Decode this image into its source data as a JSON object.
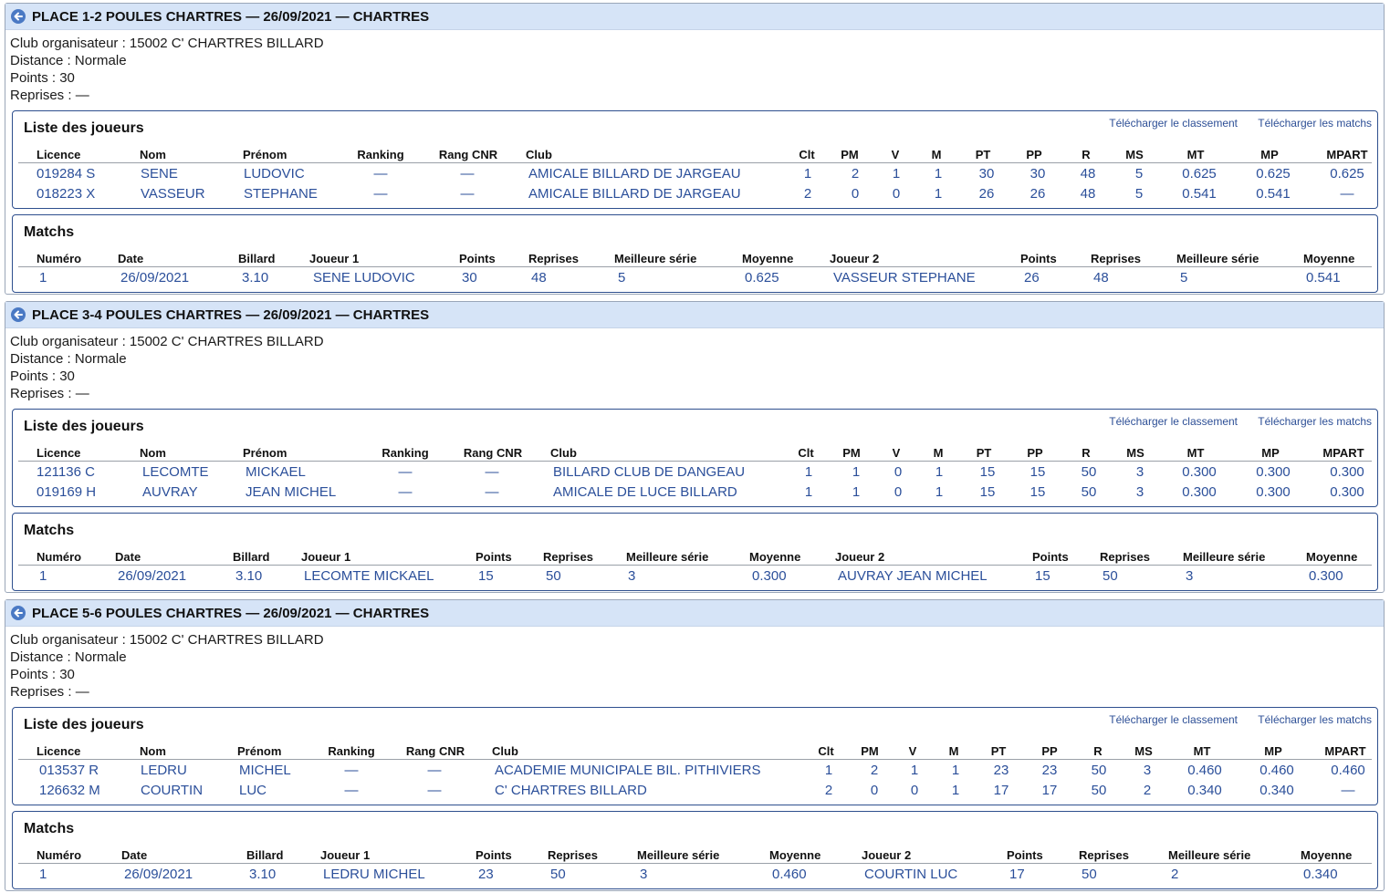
{
  "labels": {
    "club": "Club organisateur : ",
    "distance": "Distance : ",
    "points": "Points : ",
    "reprises": "Reprises : ",
    "players_title": "Liste des joueurs",
    "matches_title": "Matchs",
    "download_ranking": "Télécharger le classement",
    "download_matches": "Télécharger les matchs"
  },
  "player_headers": {
    "licence": "Licence",
    "nom": "Nom",
    "prenom": "Prénom",
    "ranking": "Ranking",
    "rang_cnr": "Rang CNR",
    "club": "Club",
    "clt": "Clt",
    "pm": "PM",
    "v": "V",
    "m": "M",
    "pt": "PT",
    "pp": "PP",
    "r": "R",
    "ms": "MS",
    "mt": "MT",
    "mp": "MP",
    "mpart": "MPART"
  },
  "match_headers": {
    "numero": "Numéro",
    "date": "Date",
    "billard": "Billard",
    "joueur1": "Joueur 1",
    "points1": "Points",
    "reprises1": "Reprises",
    "serie1": "Meilleure série",
    "moyenne1": "Moyenne",
    "joueur2": "Joueur 2",
    "points2": "Points",
    "reprises2": "Reprises",
    "serie2": "Meilleure série",
    "moyenne2": "Moyenne"
  },
  "sections": [
    {
      "title": "PLACE 1-2 POULES CHARTRES — 26/09/2021 — CHARTRES",
      "club": "15002 C' CHARTRES BILLARD",
      "distance": "Normale",
      "points": "30",
      "reprises": "—",
      "players": [
        {
          "licence": "019284 S",
          "nom": "SENE",
          "prenom": "LUDOVIC",
          "ranking": "—",
          "rang_cnr": "—",
          "club": "AMICALE BILLARD DE JARGEAU",
          "clt": "1",
          "pm": "2",
          "v": "1",
          "m": "1",
          "pt": "30",
          "pp": "30",
          "r": "48",
          "ms": "5",
          "mt": "0.625",
          "mp": "0.625",
          "mpart": "0.625"
        },
        {
          "licence": "018223 X",
          "nom": "VASSEUR",
          "prenom": "STEPHANE",
          "ranking": "—",
          "rang_cnr": "—",
          "club": "AMICALE BILLARD DE JARGEAU",
          "clt": "2",
          "pm": "0",
          "v": "0",
          "m": "1",
          "pt": "26",
          "pp": "26",
          "r": "48",
          "ms": "5",
          "mt": "0.541",
          "mp": "0.541",
          "mpart": "—"
        }
      ],
      "matches": [
        {
          "numero": "1",
          "date": "26/09/2021",
          "billard": "3.10",
          "joueur1": "SENE LUDOVIC",
          "points1": "30",
          "reprises1": "48",
          "serie1": "5",
          "moyenne1": "0.625",
          "joueur2": "VASSEUR STEPHANE",
          "points2": "26",
          "reprises2": "48",
          "serie2": "5",
          "moyenne2": "0.541"
        }
      ]
    },
    {
      "title": "PLACE 3-4 POULES CHARTRES — 26/09/2021 — CHARTRES",
      "club": "15002 C' CHARTRES BILLARD",
      "distance": "Normale",
      "points": "30",
      "reprises": "—",
      "players": [
        {
          "licence": "121136 C",
          "nom": "LECOMTE",
          "prenom": "MICKAEL",
          "ranking": "—",
          "rang_cnr": "—",
          "club": "BILLARD CLUB DE DANGEAU",
          "clt": "1",
          "pm": "1",
          "v": "0",
          "m": "1",
          "pt": "15",
          "pp": "15",
          "r": "50",
          "ms": "3",
          "mt": "0.300",
          "mp": "0.300",
          "mpart": "0.300"
        },
        {
          "licence": "019169 H",
          "nom": "AUVRAY",
          "prenom": "JEAN MICHEL",
          "ranking": "—",
          "rang_cnr": "—",
          "club": "AMICALE DE LUCE BILLARD",
          "clt": "1",
          "pm": "1",
          "v": "0",
          "m": "1",
          "pt": "15",
          "pp": "15",
          "r": "50",
          "ms": "3",
          "mt": "0.300",
          "mp": "0.300",
          "mpart": "0.300"
        }
      ],
      "matches": [
        {
          "numero": "1",
          "date": "26/09/2021",
          "billard": "3.10",
          "joueur1": "LECOMTE MICKAEL",
          "points1": "15",
          "reprises1": "50",
          "serie1": "3",
          "moyenne1": "0.300",
          "joueur2": "AUVRAY JEAN MICHEL",
          "points2": "15",
          "reprises2": "50",
          "serie2": "3",
          "moyenne2": "0.300"
        }
      ]
    },
    {
      "title": "PLACE 5-6 POULES CHARTRES — 26/09/2021 — CHARTRES",
      "club": "15002 C' CHARTRES BILLARD",
      "distance": "Normale",
      "points": "30",
      "reprises": "—",
      "players": [
        {
          "licence": "013537 R",
          "nom": "LEDRU",
          "prenom": "MICHEL",
          "ranking": "—",
          "rang_cnr": "—",
          "club": "ACADEMIE MUNICIPALE BIL. PITHIVIERS",
          "clt": "1",
          "pm": "2",
          "v": "1",
          "m": "1",
          "pt": "23",
          "pp": "23",
          "r": "50",
          "ms": "3",
          "mt": "0.460",
          "mp": "0.460",
          "mpart": "0.460"
        },
        {
          "licence": "126632 M",
          "nom": "COURTIN",
          "prenom": "LUC",
          "ranking": "—",
          "rang_cnr": "—",
          "club": "C' CHARTRES BILLARD",
          "clt": "2",
          "pm": "0",
          "v": "0",
          "m": "1",
          "pt": "17",
          "pp": "17",
          "r": "50",
          "ms": "2",
          "mt": "0.340",
          "mp": "0.340",
          "mpart": "—"
        }
      ],
      "matches": [
        {
          "numero": "1",
          "date": "26/09/2021",
          "billard": "3.10",
          "joueur1": "LEDRU MICHEL",
          "points1": "23",
          "reprises1": "50",
          "serie1": "3",
          "moyenne1": "0.460",
          "joueur2": "COURTIN LUC",
          "points2": "17",
          "reprises2": "50",
          "serie2": "2",
          "moyenne2": "0.340"
        }
      ]
    }
  ]
}
